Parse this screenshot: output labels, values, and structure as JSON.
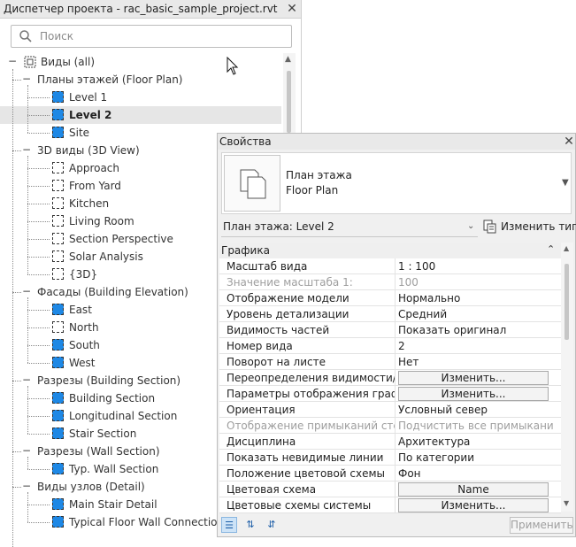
{
  "project_browser": {
    "title": "Диспетчер проекта - rac_basic_sample_project.rvt",
    "search_placeholder": "Поиск",
    "rows": [
      {
        "label": "Виды (all)",
        "level": 0,
        "type": "root"
      },
      {
        "label": "Планы этажей (Floor Plan)",
        "level": 1,
        "type": "group"
      },
      {
        "label": "Level 1",
        "level": 2,
        "type": "view",
        "icon": "filled"
      },
      {
        "label": "Level 2",
        "level": 2,
        "type": "view",
        "icon": "filled",
        "selected": true
      },
      {
        "label": "Site",
        "level": 2,
        "type": "view",
        "icon": "filled"
      },
      {
        "label": "3D виды (3D View)",
        "level": 1,
        "type": "group"
      },
      {
        "label": "Approach",
        "level": 2,
        "type": "view",
        "icon": "empty"
      },
      {
        "label": "From Yard",
        "level": 2,
        "type": "view",
        "icon": "empty"
      },
      {
        "label": "Kitchen",
        "level": 2,
        "type": "view",
        "icon": "empty"
      },
      {
        "label": "Living Room",
        "level": 2,
        "type": "view",
        "icon": "empty"
      },
      {
        "label": "Section Perspective",
        "level": 2,
        "type": "view",
        "icon": "empty"
      },
      {
        "label": "Solar Analysis",
        "level": 2,
        "type": "view",
        "icon": "empty"
      },
      {
        "label": "{3D}",
        "level": 2,
        "type": "view",
        "icon": "empty"
      },
      {
        "label": "Фасады (Building Elevation)",
        "level": 1,
        "type": "group"
      },
      {
        "label": "East",
        "level": 2,
        "type": "view",
        "icon": "filled"
      },
      {
        "label": "North",
        "level": 2,
        "type": "view",
        "icon": "empty"
      },
      {
        "label": "South",
        "level": 2,
        "type": "view",
        "icon": "filled"
      },
      {
        "label": "West",
        "level": 2,
        "type": "view",
        "icon": "filled"
      },
      {
        "label": "Разрезы (Building Section)",
        "level": 1,
        "type": "group"
      },
      {
        "label": "Building Section",
        "level": 2,
        "type": "view",
        "icon": "filled"
      },
      {
        "label": "Longitudinal Section",
        "level": 2,
        "type": "view",
        "icon": "filled"
      },
      {
        "label": "Stair Section",
        "level": 2,
        "type": "view",
        "icon": "filled"
      },
      {
        "label": "Разрезы (Wall Section)",
        "level": 1,
        "type": "group"
      },
      {
        "label": "Typ. Wall Section",
        "level": 2,
        "type": "view",
        "icon": "filled"
      },
      {
        "label": "Виды узлов (Detail)",
        "level": 1,
        "type": "group"
      },
      {
        "label": "Main Stair Detail",
        "level": 2,
        "type": "view",
        "icon": "filled"
      },
      {
        "label": "Typical Floor Wall Connection",
        "level": 2,
        "type": "view",
        "icon": "filled"
      }
    ]
  },
  "properties": {
    "title": "Свойства",
    "type_name_line1": "План этажа",
    "type_name_line2": "Floor Plan",
    "instance_selector": "План этажа: Level 2",
    "edit_type_label": "Изменить тип",
    "group_label": "Графика",
    "rows": [
      {
        "name": "Масштаб вида",
        "value": "1 : 100"
      },
      {
        "name": "Значение масштаба    1:",
        "value": "100",
        "disabled": true
      },
      {
        "name": "Отображение модели",
        "value": "Нормально"
      },
      {
        "name": "Уровень детализации",
        "value": "Средний"
      },
      {
        "name": "Видимость частей",
        "value": "Показать оригинал"
      },
      {
        "name": "Номер вида",
        "value": "2"
      },
      {
        "name": "Поворот на листе",
        "value": "Нет"
      },
      {
        "name": "Переопределения видимости/гр...",
        "value": "Изменить...",
        "button": true
      },
      {
        "name": "Параметры отображения графики",
        "value": "Изменить...",
        "button": true
      },
      {
        "name": "Ориентация",
        "value": "Условный север"
      },
      {
        "name": "Отображение примыканий стен",
        "value": "Подчистить все примыкани...",
        "disabled": true
      },
      {
        "name": "Дисциплина",
        "value": "Архитектура"
      },
      {
        "name": "Показать невидимые линии",
        "value": "По категории"
      },
      {
        "name": "Положение цветовой схемы",
        "value": "Фон"
      },
      {
        "name": "Цветовая схема",
        "value": "Name",
        "button": true
      },
      {
        "name": "Цветовые схемы системы",
        "value": "Изменить...",
        "button": true
      }
    ],
    "apply_label": "Применить"
  },
  "colors": {
    "view_icon": "#1e88e5",
    "selected_row": "#e6e6e6"
  }
}
